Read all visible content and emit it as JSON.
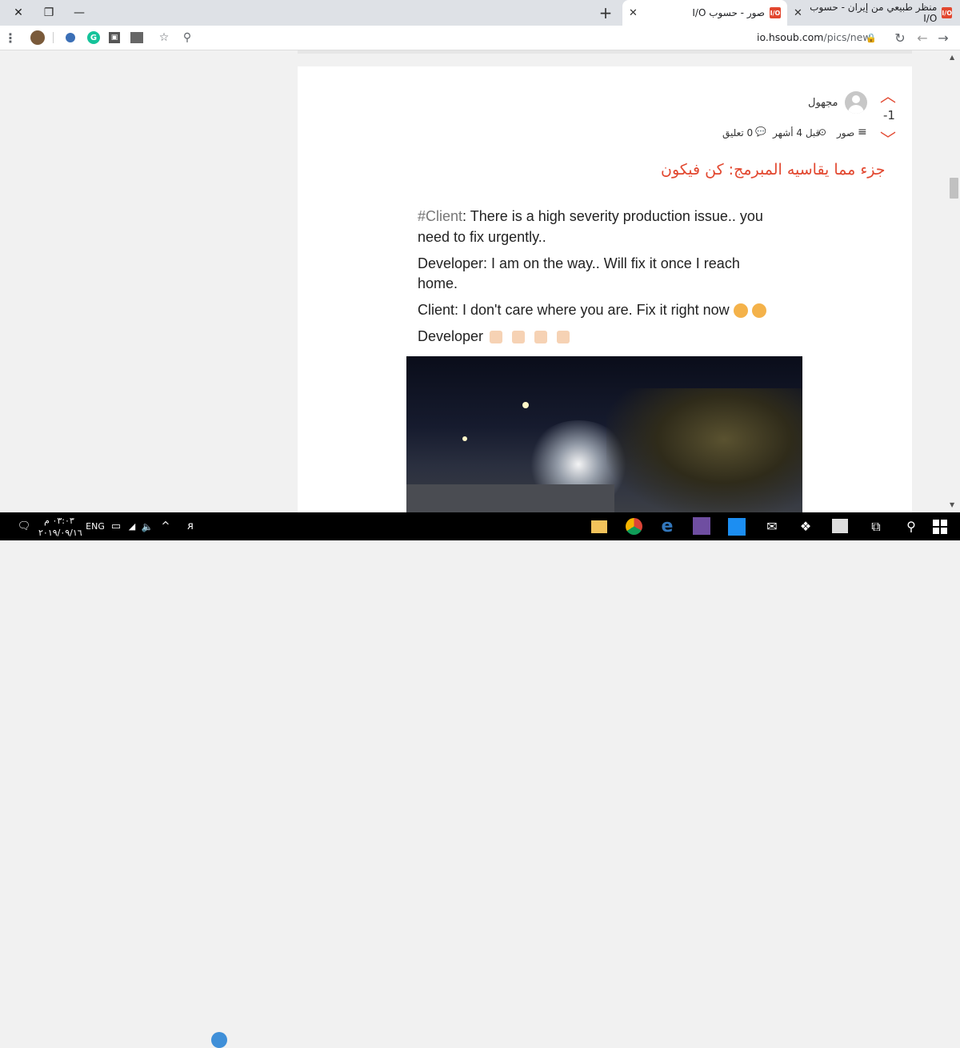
{
  "browser": {
    "tabs": [
      {
        "title": "منظر طبيعي من إيران - حسوب I/O",
        "active": false
      },
      {
        "title": "صور - حسوب I/O",
        "active": true
      }
    ],
    "new_tab": "+",
    "url_host": "io.hsoub.com",
    "url_path": "/pics/new",
    "window_controls": {
      "close": "✕",
      "restore": "❐",
      "minimize": "—"
    }
  },
  "post": {
    "vote_count": "-1",
    "author": "مجهول",
    "category": "صور",
    "time": "قبل 4 أشهر",
    "comments": "0 تعليق",
    "title": "جزء مما يقاسيه المبرمج: كن فيكون",
    "image_lines": {
      "l1_tag": "#Client",
      "l1_rest": ": There is a high severity production issue.. you",
      "l2": "need to fix urgently..",
      "l3": "Developer: I am on the way.. Will fix it once I reach",
      "l4": "home.",
      "l5": "Client: I don't care where you are. Fix it right now",
      "l6": "Developer"
    }
  },
  "taskbar": {
    "time": "٠٣:٠٣ م",
    "date": "٢٠١٩/٠٩/١٦",
    "language": "ENG"
  },
  "colors": {
    "accent": "#e2472f"
  }
}
